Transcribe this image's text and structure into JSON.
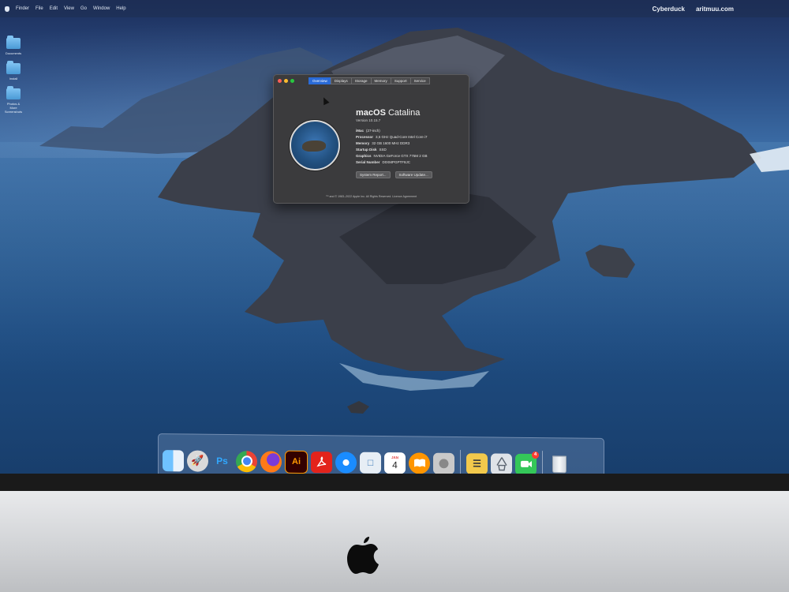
{
  "menubar": {
    "items": [
      "Finder",
      "File",
      "Edit",
      "View",
      "Go",
      "Window",
      "Help"
    ],
    "right_items": [
      "Cyberduck",
      "aritmuu.com"
    ]
  },
  "desktop": {
    "items": [
      {
        "label": "Documents",
        "icon": "folder-icon"
      },
      {
        "label": "Install",
        "icon": "folder-icon"
      },
      {
        "label": "Photos & More Screenshots",
        "icon": "folder-icon"
      }
    ]
  },
  "about_window": {
    "tabs": [
      "Overview",
      "Displays",
      "Storage",
      "Memory",
      "Support",
      "Service"
    ],
    "active_tab": "Overview",
    "os_name_prefix": "macOS",
    "os_name_suffix": "Catalina",
    "version": "Version 10.15.7",
    "specs": [
      {
        "key": "iMac",
        "value": "(27-inch)"
      },
      {
        "key": "Processor",
        "value": "3,5 GHz Quad-Core Intel Core i7"
      },
      {
        "key": "Memory",
        "value": "32 GB 1600 MHz DDR3"
      },
      {
        "key": "Startup Disk",
        "value": "SSD"
      },
      {
        "key": "Graphics",
        "value": "NVIDIA GeForce GTX 775M 2 GB"
      },
      {
        "key": "Serial Number",
        "value": "D0XMPGPTF8JC"
      }
    ],
    "buttons": {
      "system_report": "System Report...",
      "software_update": "Software Update..."
    },
    "copyright": "™ and © 1983–2022 Apple Inc. All Rights Reserved. Licence Agreement"
  },
  "dock": {
    "apps": [
      {
        "name": "Finder",
        "icon": "finder-icon"
      },
      {
        "name": "Launchpad",
        "icon": "launchpad-icon"
      },
      {
        "name": "Photoshop",
        "icon": "photoshop-icon",
        "glyph": "Ps"
      },
      {
        "name": "Chrome",
        "icon": "chrome-icon"
      },
      {
        "name": "Firefox",
        "icon": "firefox-icon"
      },
      {
        "name": "Illustrator",
        "icon": "illustrator-icon",
        "glyph": "Ai"
      },
      {
        "name": "Acrobat",
        "icon": "acrobat-icon"
      },
      {
        "name": "Safari",
        "icon": "safari-icon"
      },
      {
        "name": "Preview",
        "icon": "preview-icon"
      },
      {
        "name": "Calendar",
        "icon": "calendar-icon",
        "month": "JAN",
        "day": "4"
      },
      {
        "name": "Books",
        "icon": "books-icon"
      },
      {
        "name": "System Preferences",
        "icon": "system-preferences-icon"
      },
      {
        "name": "Cyberduck",
        "icon": "cyberduck-icon"
      },
      {
        "name": "Archive Utility",
        "icon": "archive-utility-icon"
      },
      {
        "name": "FaceTime",
        "icon": "facetime-icon",
        "badge": "4"
      },
      {
        "name": "Trash",
        "icon": "trash-icon"
      }
    ]
  },
  "colors": {
    "accent": "#2a6bd8",
    "window_bg": "#3b3b3d",
    "badge": "#ff3b30"
  }
}
